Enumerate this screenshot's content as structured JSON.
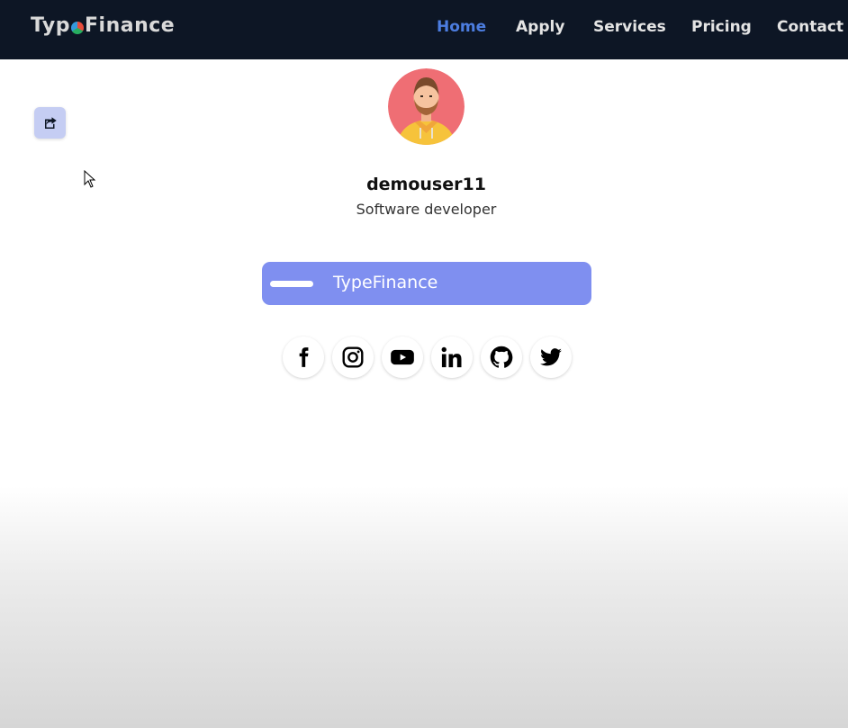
{
  "navbar": {
    "brand_prefix": "Typ",
    "brand_suffix": "Finance",
    "links": [
      {
        "label": "Home",
        "active": true
      },
      {
        "label": "Apply",
        "active": false
      },
      {
        "label": "Services",
        "active": false
      },
      {
        "label": "Pricing",
        "active": false
      },
      {
        "label": "Contact",
        "active": false
      }
    ]
  },
  "profile": {
    "username": "demouser11",
    "role": "Software developer",
    "link_card": {
      "label": "TypeFinance"
    },
    "socials": [
      {
        "name": "facebook-icon"
      },
      {
        "name": "instagram-icon"
      },
      {
        "name": "youtube-icon"
      },
      {
        "name": "linkedin-icon"
      },
      {
        "name": "github-icon"
      },
      {
        "name": "twitter-icon"
      }
    ]
  },
  "colors": {
    "navbar_bg": "#0d1625",
    "nav_active": "#4c7de0",
    "link_card_bg": "#7f8ff0",
    "share_button_bg": "#c5cdf3"
  }
}
